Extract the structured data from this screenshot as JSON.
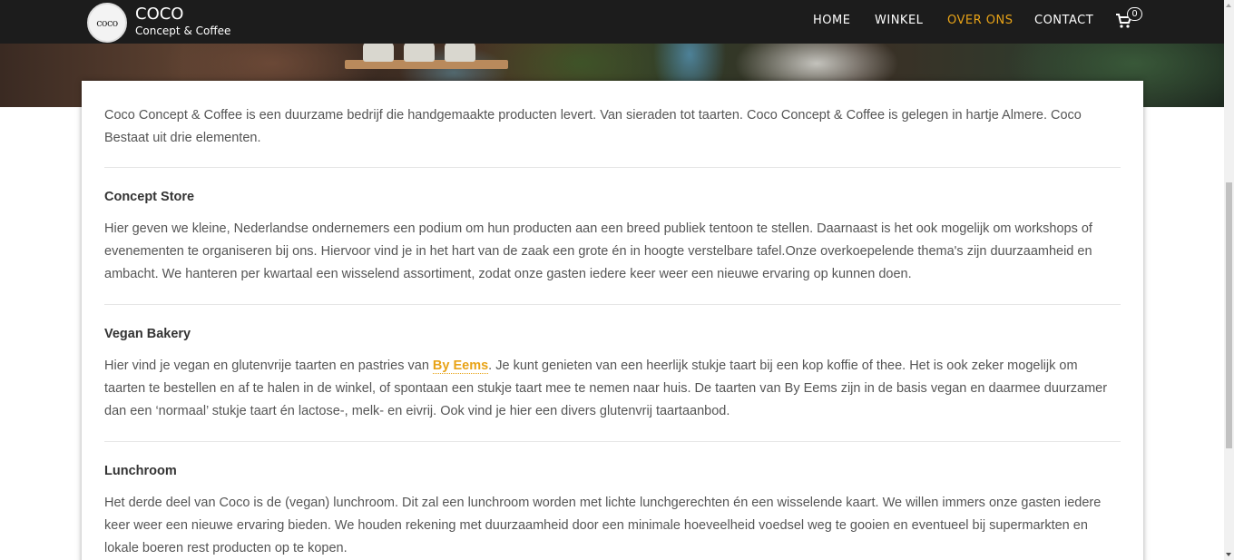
{
  "header": {
    "logo_text": "coco",
    "brand_name": "COCO",
    "brand_tagline": "Concept & Coffee",
    "nav": [
      {
        "label": "HOME"
      },
      {
        "label": "WINKEL"
      },
      {
        "label": "OVER ONS",
        "active": true
      },
      {
        "label": "CONTACT"
      }
    ],
    "cart_count": "0",
    "accent_color": "#e8a317"
  },
  "content": {
    "intro": "Coco Concept & Coffee is een duurzame bedrijf die handgemaakte producten levert. Van sieraden tot taarten. Coco Concept & Coffee is gelegen in hartje Almere. Coco Bestaat uit drie elementen.",
    "sections": [
      {
        "title": "Concept Store",
        "text": "Hier geven we kleine, Nederlandse ondernemers een podium om hun producten aan een breed publiek tentoon te stellen. Daarnaast is het ook mogelijk om workshops of evenementen te organiseren bij ons. Hiervoor vind je in het hart van de zaak een grote én in hoogte verstelbare tafel.Onze overkoepelende thema's zijn duurzaamheid en ambacht. We hanteren per kwartaal een wisselend assortiment, zodat onze gasten iedere keer weer een nieuwe ervaring op kunnen doen."
      },
      {
        "title": "Vegan Bakery",
        "text_before": "Hier vind je vegan en glutenvrije taarten en pastries van ",
        "link_text": "By Eems",
        "text_after": ". Je  kunt genieten van een heerlijk stukje taart bij een kop koffie of thee. Het is ook zeker mogelijk om taarten te bestellen en af te halen in de winkel, of spontaan een stukje taart mee te nemen naar huis. De taarten van By Eems zijn in de basis vegan en daarmee duurzamer dan een ‘normaal’ stukje taart én lactose-, melk- en eivrij. Ook vind je hier een divers glutenvrij taartaanbod."
      },
      {
        "title": "Lunchroom",
        "text": "Het derde deel van Coco is de (vegan) lunchroom. Dit zal een lunchroom worden met lichte lunchgerechten én een wisselende kaart. We willen immers onze gasten iedere keer weer een nieuwe ervaring bieden. We houden rekening met duurzaamheid door een minimale hoeveelheid voedsel weg te gooien en eventueel bij supermarkten en lokale boeren rest producten op te kopen."
      }
    ]
  }
}
